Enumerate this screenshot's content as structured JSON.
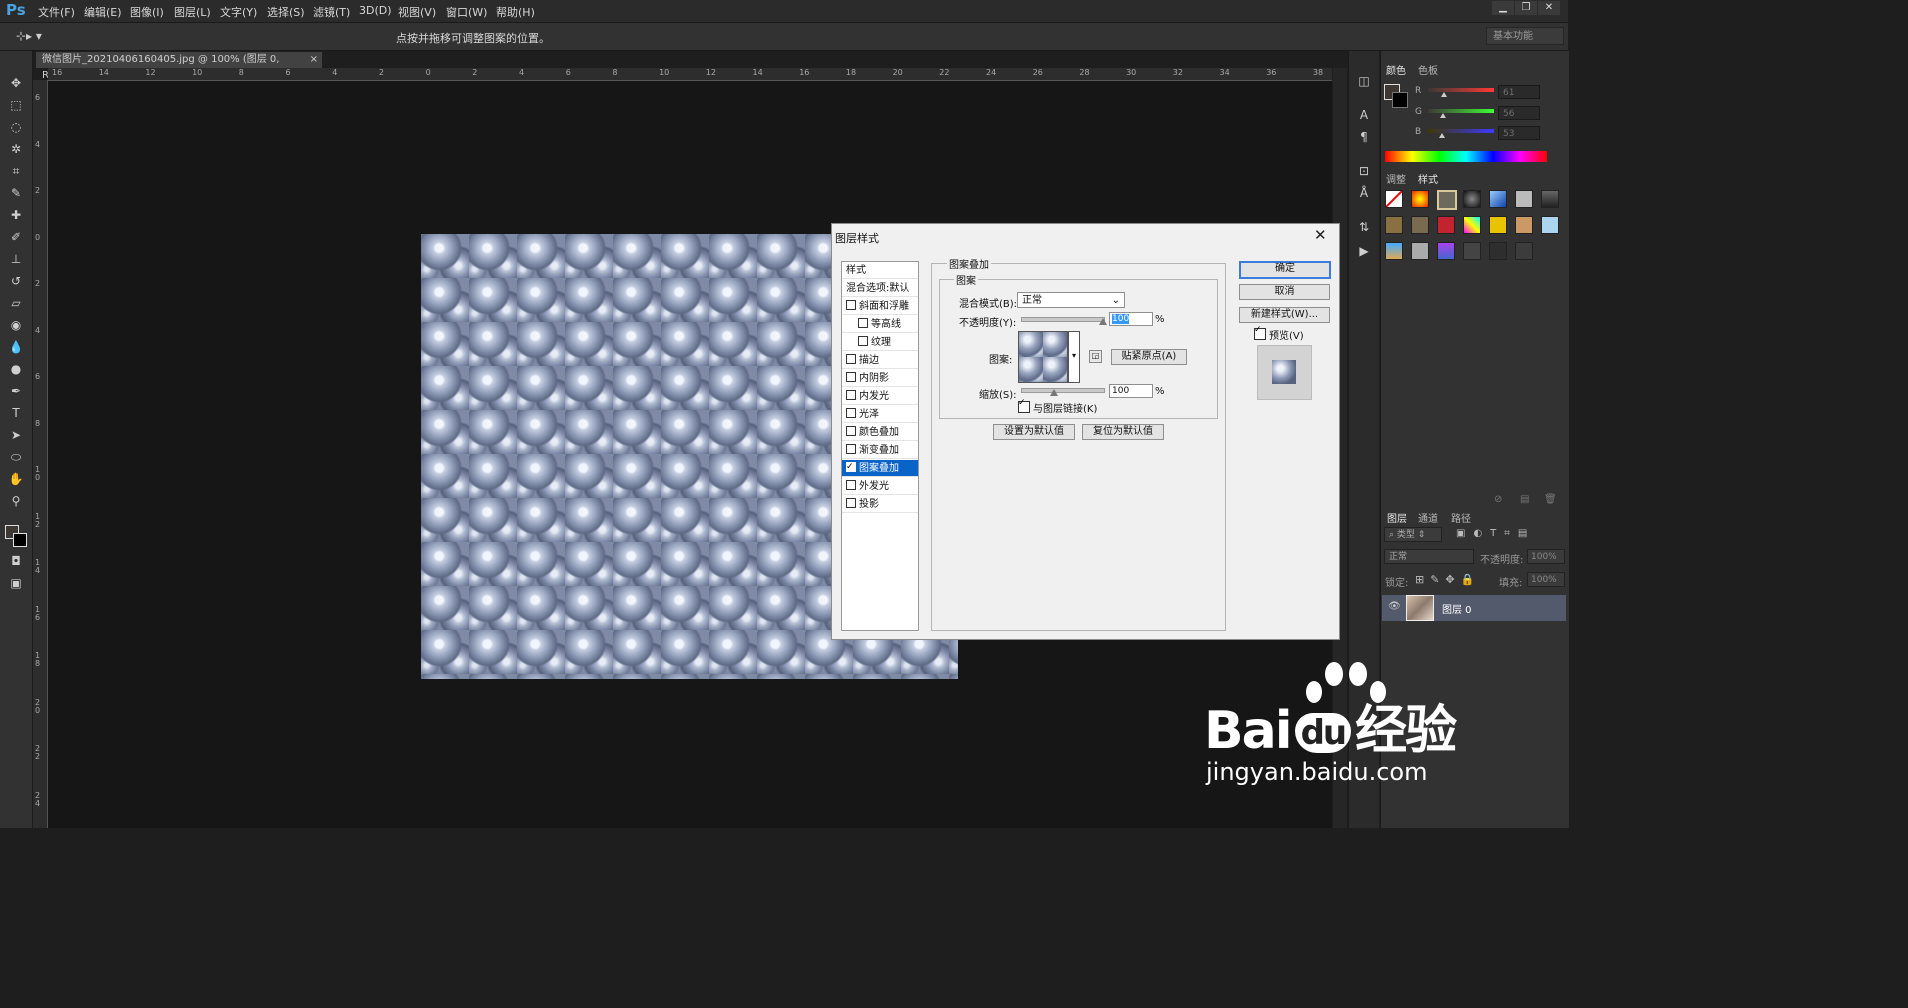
{
  "app": {
    "logo": "Ps"
  },
  "menu": [
    "文件(F)",
    "编辑(E)",
    "图像(I)",
    "图层(L)",
    "文字(Y)",
    "选择(S)",
    "滤镜(T)",
    "3D(D)",
    "视图(V)",
    "窗口(W)",
    "帮助(H)"
  ],
  "options_bar": {
    "hint": "点按并拖移可调整图案的位置。",
    "workspace": "基本功能"
  },
  "document": {
    "tab_title": "微信图片_20210406160405.jpg @ 100% (图层 0, RGB/8#) *",
    "close": "×"
  },
  "ruler": {
    "h_ticks": [
      "16",
      "14",
      "12",
      "10",
      "8",
      "6",
      "4",
      "2",
      "0",
      "2",
      "4",
      "6",
      "8",
      "10",
      "12",
      "14",
      "16",
      "18",
      "20",
      "22",
      "24",
      "26",
      "28",
      "30",
      "32",
      "34",
      "36",
      "38"
    ],
    "v_ticks": [
      "6",
      "4",
      "2",
      "0",
      "2",
      "4",
      "6",
      "8",
      "1 0",
      "1 2",
      "1 4",
      "1 6",
      "1 8",
      "2 0",
      "2 2",
      "2 4"
    ]
  },
  "color_panel": {
    "tabs": [
      "颜色",
      "色板"
    ],
    "channels": [
      {
        "label": "R",
        "value": "61",
        "level": 0.24
      },
      {
        "label": "G",
        "value": "56",
        "level": 0.22
      },
      {
        "label": "B",
        "value": "53",
        "level": 0.21
      }
    ]
  },
  "styles_panel": {
    "tabs": [
      "调整",
      "样式"
    ]
  },
  "layers_panel": {
    "tabs": [
      "图层",
      "通道",
      "路径"
    ],
    "kind_filter": "类型",
    "blend_mode": "正常",
    "opacity_label": "不透明度:",
    "opacity_value": "100%",
    "lock_label": "锁定:",
    "fill_label": "填充:",
    "fill_value": "100%",
    "layer_name": "图层 0"
  },
  "dialog": {
    "title": "图层样式",
    "close": "✕",
    "list": [
      {
        "label": "样式",
        "checkbox": false,
        "indent": false,
        "header": true
      },
      {
        "label": "混合选项:默认",
        "checkbox": false,
        "indent": false,
        "header": true
      },
      {
        "label": "斜面和浮雕",
        "checkbox": true,
        "checked": false,
        "indent": false
      },
      {
        "label": "等高线",
        "checkbox": true,
        "checked": false,
        "indent": true
      },
      {
        "label": "纹理",
        "checkbox": true,
        "checked": false,
        "indent": true
      },
      {
        "label": "描边",
        "checkbox": true,
        "checked": false,
        "indent": false
      },
      {
        "label": "内阴影",
        "checkbox": true,
        "checked": false,
        "indent": false
      },
      {
        "label": "内发光",
        "checkbox": true,
        "checked": false,
        "indent": false
      },
      {
        "label": "光泽",
        "checkbox": true,
        "checked": false,
        "indent": false
      },
      {
        "label": "颜色叠加",
        "checkbox": true,
        "checked": false,
        "indent": false
      },
      {
        "label": "渐变叠加",
        "checkbox": true,
        "checked": false,
        "indent": false
      },
      {
        "label": "图案叠加",
        "checkbox": true,
        "checked": true,
        "indent": false,
        "selected": true
      },
      {
        "label": "外发光",
        "checkbox": true,
        "checked": false,
        "indent": false
      },
      {
        "label": "投影",
        "checkbox": true,
        "checked": false,
        "indent": false
      }
    ],
    "section_title": "图案叠加",
    "group_title": "图案",
    "blend_label": "混合模式(B):",
    "blend_value": "正常",
    "opacity_label": "不透明度(Y):",
    "opacity_value": "100",
    "opacity_level": 1.0,
    "pct": "%",
    "pattern_label": "图案:",
    "snap_button": "贴紧原点(A)",
    "scale_label": "缩放(S):",
    "scale_value": "100",
    "scale_level": 0.4,
    "link_label": "与图层链接(K)",
    "link_checked": true,
    "make_default": "设置为默认值",
    "reset_default": "复位为默认值",
    "ok": "确定",
    "cancel": "取消",
    "new_style": "新建样式(W)...",
    "preview_label": "预览(V)",
    "preview_checked": true
  },
  "watermark": {
    "brand": "Bai",
    "brand2": "du",
    "cn": "经验",
    "url": "jingyan.baidu.com"
  }
}
